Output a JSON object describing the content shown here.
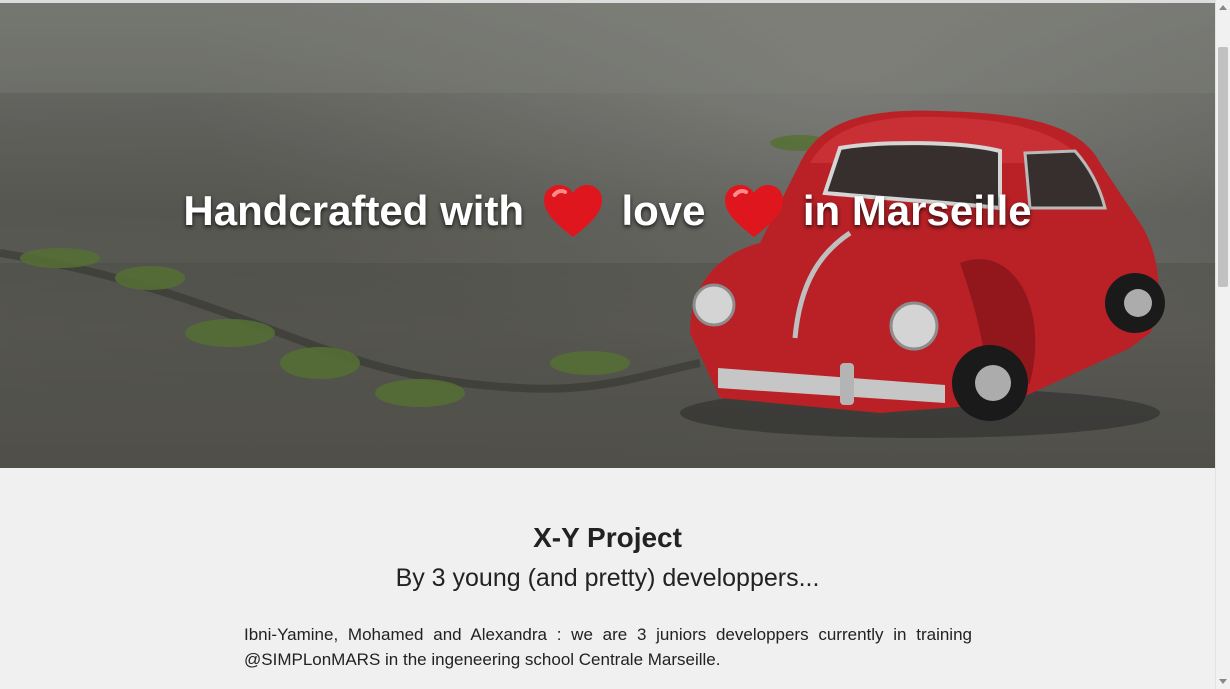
{
  "hero": {
    "title_part1": "Handcrafted with",
    "title_part2": "love",
    "title_part3": "in Marseille",
    "heart_icon": "red-heart-emoji",
    "image_subject": "red-toy-car-photo"
  },
  "project": {
    "title": "X-Y Project",
    "subtitle": "By 3 young (and pretty) developpers...",
    "intro": "Ibni-Yamine, Mohamed and Alexandra : we are 3 juniors developpers currently in training @SIMPLonMARS in the ingeneering school Centrale Marseille."
  },
  "colors": {
    "background": "#f0f0f0",
    "text": "#222222",
    "hero_text": "#ffffff",
    "heart": "#e0161e",
    "car": "#c9242a"
  }
}
